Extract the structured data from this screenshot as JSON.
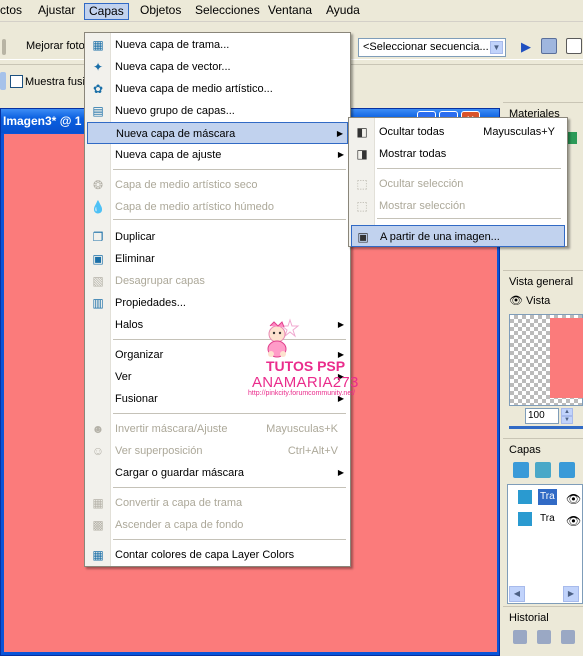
{
  "menubar": {
    "items": [
      "ctos",
      "Ajustar",
      "Capas",
      "Objetos",
      "Selecciones",
      "Ventana",
      "Ayuda"
    ]
  },
  "toolbar": {
    "enhance_label": "Mejorar foto",
    "sequence_placeholder": "<Seleccionar secuencia...",
    "sample_merged_label": "Muestra fusion"
  },
  "document": {
    "title": "Imagen3* @ 1",
    "canvas_color": "#fb7b7b"
  },
  "right_panel": {
    "materials_title": "Materiales",
    "overview_title": "Vista general",
    "preview_label": "Vista previa",
    "zoom_value": "100",
    "layers_title": "Capas",
    "layers": [
      "Tra",
      "Tra"
    ],
    "history_title": "Historial"
  },
  "main_menu": {
    "items": [
      {
        "label": "Nueva capa de trama...",
        "shortcut": "",
        "disabled": false,
        "submenu": false,
        "icon": "raster-layer-icon"
      },
      {
        "label": "Nueva capa de vector...",
        "shortcut": "",
        "disabled": false,
        "submenu": false,
        "icon": "vector-layer-icon"
      },
      {
        "label": "Nueva capa de medio artístico...",
        "shortcut": "",
        "disabled": false,
        "submenu": false,
        "icon": "art-media-layer-icon"
      },
      {
        "label": "Nuevo grupo de capas...",
        "shortcut": "",
        "disabled": false,
        "submenu": false,
        "icon": "layer-group-icon"
      },
      {
        "label": "Nueva capa de máscara",
        "shortcut": "",
        "disabled": false,
        "submenu": true,
        "icon": ""
      },
      {
        "label": "Nueva capa de ajuste",
        "shortcut": "",
        "disabled": false,
        "submenu": true,
        "icon": ""
      },
      {
        "label": "Capa de medio artístico seco",
        "shortcut": "",
        "disabled": true,
        "submenu": false,
        "icon": "dry-media-icon"
      },
      {
        "label": "Capa de medio artístico húmedo",
        "shortcut": "",
        "disabled": true,
        "submenu": false,
        "icon": "wet-media-icon"
      },
      {
        "label": "Duplicar",
        "shortcut": "",
        "disabled": false,
        "submenu": false,
        "icon": "duplicate-icon"
      },
      {
        "label": "Eliminar",
        "shortcut": "",
        "disabled": false,
        "submenu": false,
        "icon": "delete-layer-icon"
      },
      {
        "label": "Desagrupar capas",
        "shortcut": "",
        "disabled": true,
        "submenu": false,
        "icon": "ungroup-icon"
      },
      {
        "label": "Propiedades...",
        "shortcut": "",
        "disabled": false,
        "submenu": false,
        "icon": "properties-icon"
      },
      {
        "label": "Halos",
        "shortcut": "",
        "disabled": false,
        "submenu": true,
        "icon": ""
      },
      {
        "label": "Organizar",
        "shortcut": "",
        "disabled": false,
        "submenu": true,
        "icon": ""
      },
      {
        "label": "Ver",
        "shortcut": "",
        "disabled": false,
        "submenu": true,
        "icon": ""
      },
      {
        "label": "Fusionar",
        "shortcut": "",
        "disabled": false,
        "submenu": true,
        "icon": ""
      },
      {
        "label": "Invertir máscara/Ajuste",
        "shortcut": "Mayusculas+K",
        "disabled": true,
        "submenu": false,
        "icon": "invert-mask-icon"
      },
      {
        "label": "Ver superposición",
        "shortcut": "Ctrl+Alt+V",
        "disabled": true,
        "submenu": false,
        "icon": "view-overlay-icon"
      },
      {
        "label": "Cargar o guardar máscara",
        "shortcut": "",
        "disabled": false,
        "submenu": true,
        "icon": ""
      },
      {
        "label": "Convertir a capa de trama",
        "shortcut": "",
        "disabled": true,
        "submenu": false,
        "icon": "convert-raster-icon"
      },
      {
        "label": "Ascender a capa de fondo",
        "shortcut": "",
        "disabled": true,
        "submenu": false,
        "icon": "promote-background-icon"
      },
      {
        "label": "Contar colores de capa Layer Colors",
        "shortcut": "",
        "disabled": false,
        "submenu": false,
        "icon": "count-colors-icon"
      }
    ]
  },
  "sub_menu": {
    "items": [
      {
        "label": "Ocultar todas",
        "shortcut": "Mayusculas+Y",
        "disabled": false,
        "icon": "hide-all-mask-icon"
      },
      {
        "label": "Mostrar todas",
        "shortcut": "",
        "disabled": false,
        "icon": "show-all-mask-icon"
      },
      {
        "label": "Ocultar selección",
        "shortcut": "",
        "disabled": true,
        "icon": "hide-selection-icon"
      },
      {
        "label": "Mostrar selección",
        "shortcut": "",
        "disabled": true,
        "icon": "show-selection-icon"
      },
      {
        "label": "A partir de una imagen...",
        "shortcut": "",
        "disabled": false,
        "icon": "from-image-icon"
      }
    ]
  },
  "watermark": {
    "line1": "TUTOS PSP",
    "line2": "ANAMARIA273",
    "line3": "http://pinkcity.forumcommunity.net/"
  },
  "colors": {
    "highlight": "#c1d2ee",
    "highlight_border": "#316ac5",
    "canvas": "#fb7b7b",
    "title_bar": "#0a5fe0",
    "watermark": "#ea2c8c"
  }
}
